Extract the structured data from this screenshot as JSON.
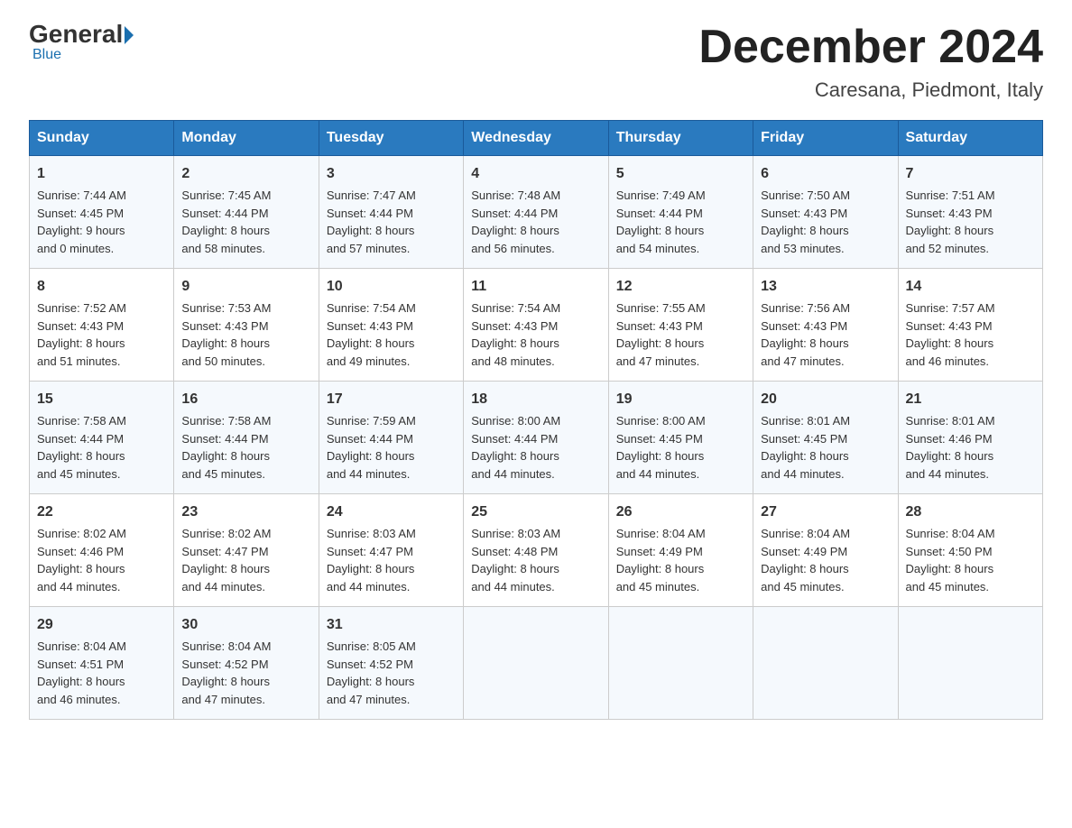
{
  "header": {
    "logo_general": "General",
    "logo_blue": "Blue",
    "main_title": "December 2024",
    "subtitle": "Caresana, Piedmont, Italy"
  },
  "days_of_week": [
    "Sunday",
    "Monday",
    "Tuesday",
    "Wednesday",
    "Thursday",
    "Friday",
    "Saturday"
  ],
  "weeks": [
    [
      {
        "day": "1",
        "sunrise": "7:44 AM",
        "sunset": "4:45 PM",
        "daylight_hours": "9",
        "daylight_minutes": "0"
      },
      {
        "day": "2",
        "sunrise": "7:45 AM",
        "sunset": "4:44 PM",
        "daylight_hours": "8",
        "daylight_minutes": "58"
      },
      {
        "day": "3",
        "sunrise": "7:47 AM",
        "sunset": "4:44 PM",
        "daylight_hours": "8",
        "daylight_minutes": "57"
      },
      {
        "day": "4",
        "sunrise": "7:48 AM",
        "sunset": "4:44 PM",
        "daylight_hours": "8",
        "daylight_minutes": "56"
      },
      {
        "day": "5",
        "sunrise": "7:49 AM",
        "sunset": "4:44 PM",
        "daylight_hours": "8",
        "daylight_minutes": "54"
      },
      {
        "day": "6",
        "sunrise": "7:50 AM",
        "sunset": "4:43 PM",
        "daylight_hours": "8",
        "daylight_minutes": "53"
      },
      {
        "day": "7",
        "sunrise": "7:51 AM",
        "sunset": "4:43 PM",
        "daylight_hours": "8",
        "daylight_minutes": "52"
      }
    ],
    [
      {
        "day": "8",
        "sunrise": "7:52 AM",
        "sunset": "4:43 PM",
        "daylight_hours": "8",
        "daylight_minutes": "51"
      },
      {
        "day": "9",
        "sunrise": "7:53 AM",
        "sunset": "4:43 PM",
        "daylight_hours": "8",
        "daylight_minutes": "50"
      },
      {
        "day": "10",
        "sunrise": "7:54 AM",
        "sunset": "4:43 PM",
        "daylight_hours": "8",
        "daylight_minutes": "49"
      },
      {
        "day": "11",
        "sunrise": "7:54 AM",
        "sunset": "4:43 PM",
        "daylight_hours": "8",
        "daylight_minutes": "48"
      },
      {
        "day": "12",
        "sunrise": "7:55 AM",
        "sunset": "4:43 PM",
        "daylight_hours": "8",
        "daylight_minutes": "47"
      },
      {
        "day": "13",
        "sunrise": "7:56 AM",
        "sunset": "4:43 PM",
        "daylight_hours": "8",
        "daylight_minutes": "47"
      },
      {
        "day": "14",
        "sunrise": "7:57 AM",
        "sunset": "4:43 PM",
        "daylight_hours": "8",
        "daylight_minutes": "46"
      }
    ],
    [
      {
        "day": "15",
        "sunrise": "7:58 AM",
        "sunset": "4:44 PM",
        "daylight_hours": "8",
        "daylight_minutes": "45"
      },
      {
        "day": "16",
        "sunrise": "7:58 AM",
        "sunset": "4:44 PM",
        "daylight_hours": "8",
        "daylight_minutes": "45"
      },
      {
        "day": "17",
        "sunrise": "7:59 AM",
        "sunset": "4:44 PM",
        "daylight_hours": "8",
        "daylight_minutes": "44"
      },
      {
        "day": "18",
        "sunrise": "8:00 AM",
        "sunset": "4:44 PM",
        "daylight_hours": "8",
        "daylight_minutes": "44"
      },
      {
        "day": "19",
        "sunrise": "8:00 AM",
        "sunset": "4:45 PM",
        "daylight_hours": "8",
        "daylight_minutes": "44"
      },
      {
        "day": "20",
        "sunrise": "8:01 AM",
        "sunset": "4:45 PM",
        "daylight_hours": "8",
        "daylight_minutes": "44"
      },
      {
        "day": "21",
        "sunrise": "8:01 AM",
        "sunset": "4:46 PM",
        "daylight_hours": "8",
        "daylight_minutes": "44"
      }
    ],
    [
      {
        "day": "22",
        "sunrise": "8:02 AM",
        "sunset": "4:46 PM",
        "daylight_hours": "8",
        "daylight_minutes": "44"
      },
      {
        "day": "23",
        "sunrise": "8:02 AM",
        "sunset": "4:47 PM",
        "daylight_hours": "8",
        "daylight_minutes": "44"
      },
      {
        "day": "24",
        "sunrise": "8:03 AM",
        "sunset": "4:47 PM",
        "daylight_hours": "8",
        "daylight_minutes": "44"
      },
      {
        "day": "25",
        "sunrise": "8:03 AM",
        "sunset": "4:48 PM",
        "daylight_hours": "8",
        "daylight_minutes": "44"
      },
      {
        "day": "26",
        "sunrise": "8:04 AM",
        "sunset": "4:49 PM",
        "daylight_hours": "8",
        "daylight_minutes": "45"
      },
      {
        "day": "27",
        "sunrise": "8:04 AM",
        "sunset": "4:49 PM",
        "daylight_hours": "8",
        "daylight_minutes": "45"
      },
      {
        "day": "28",
        "sunrise": "8:04 AM",
        "sunset": "4:50 PM",
        "daylight_hours": "8",
        "daylight_minutes": "45"
      }
    ],
    [
      {
        "day": "29",
        "sunrise": "8:04 AM",
        "sunset": "4:51 PM",
        "daylight_hours": "8",
        "daylight_minutes": "46"
      },
      {
        "day": "30",
        "sunrise": "8:04 AM",
        "sunset": "4:52 PM",
        "daylight_hours": "8",
        "daylight_minutes": "47"
      },
      {
        "day": "31",
        "sunrise": "8:05 AM",
        "sunset": "4:52 PM",
        "daylight_hours": "8",
        "daylight_minutes": "47"
      },
      null,
      null,
      null,
      null
    ]
  ]
}
